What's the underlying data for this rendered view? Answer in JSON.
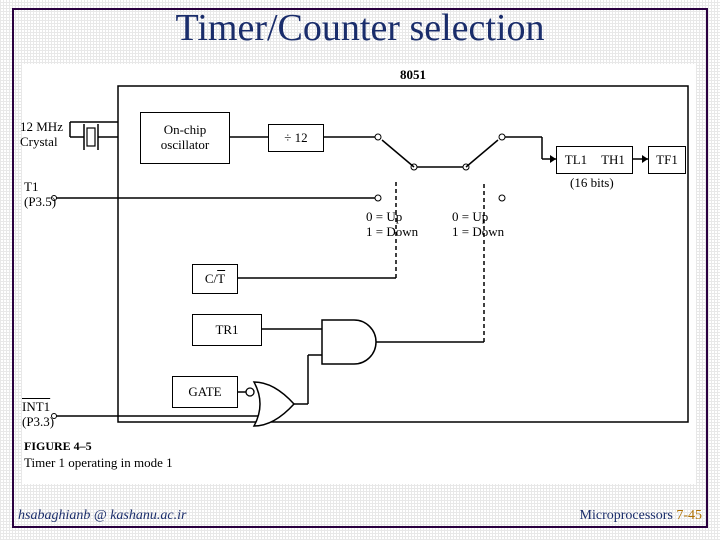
{
  "title": "Timer/Counter selection",
  "footer": {
    "left": "hsabaghianb @ kashanu.ac.ir",
    "right_label": "Microprocessors",
    "right_page": "7-45"
  },
  "diagram": {
    "chip_label": "8051",
    "crystal": "12 MHz\nCrystal",
    "osc": "On-chip\noscillator",
    "div": "÷ 12",
    "t1": "T1\n(P3.5)",
    "ct": "C/T",
    "tr1": "TR1",
    "gate": "GATE",
    "int1": "INT1\n(P3.3)",
    "sw_legend": "0 = Up\n1 = Down",
    "tl1": "TL1",
    "th1": "TH1",
    "tf1": "TF1",
    "bits": "(16 bits)",
    "figure_no": "FIGURE 4–5",
    "caption": "Timer 1 operating in mode 1"
  }
}
